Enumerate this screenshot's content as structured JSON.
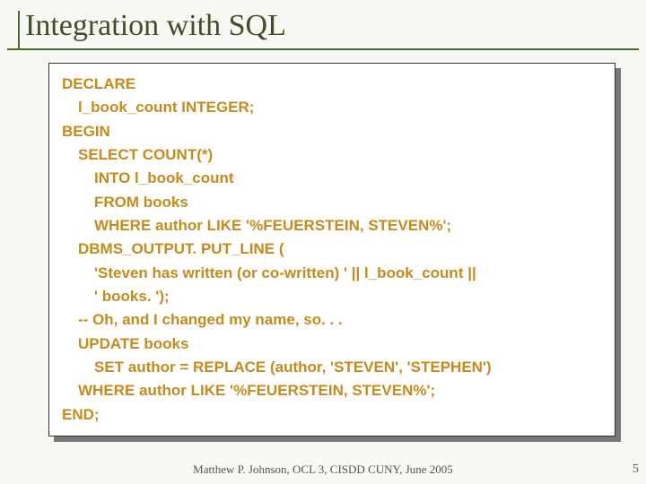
{
  "title": "Integration with SQL",
  "code": {
    "l1": "DECLARE",
    "l2": "l_book_count INTEGER;",
    "l3": "BEGIN",
    "l4": "SELECT COUNT(*)",
    "l5": "INTO l_book_count",
    "l6": "FROM books",
    "l7": "WHERE author LIKE '%FEUERSTEIN, STEVEN%';",
    "l8": "DBMS_OUTPUT. PUT_LINE (",
    "l9": "'Steven has written (or co-written) ' || l_book_count ||",
    "l10": "' books. ');",
    "l11": "-- Oh, and I changed my name, so. . .",
    "l12": "UPDATE books",
    "l13": "SET author = REPLACE (author, 'STEVEN', 'STEPHEN')",
    "l14": "WHERE author LIKE '%FEUERSTEIN, STEVEN%';",
    "l15": "END;"
  },
  "footer": "Matthew P. Johnson, OCL 3, CISDD CUNY, June 2005",
  "pagenum": "5"
}
